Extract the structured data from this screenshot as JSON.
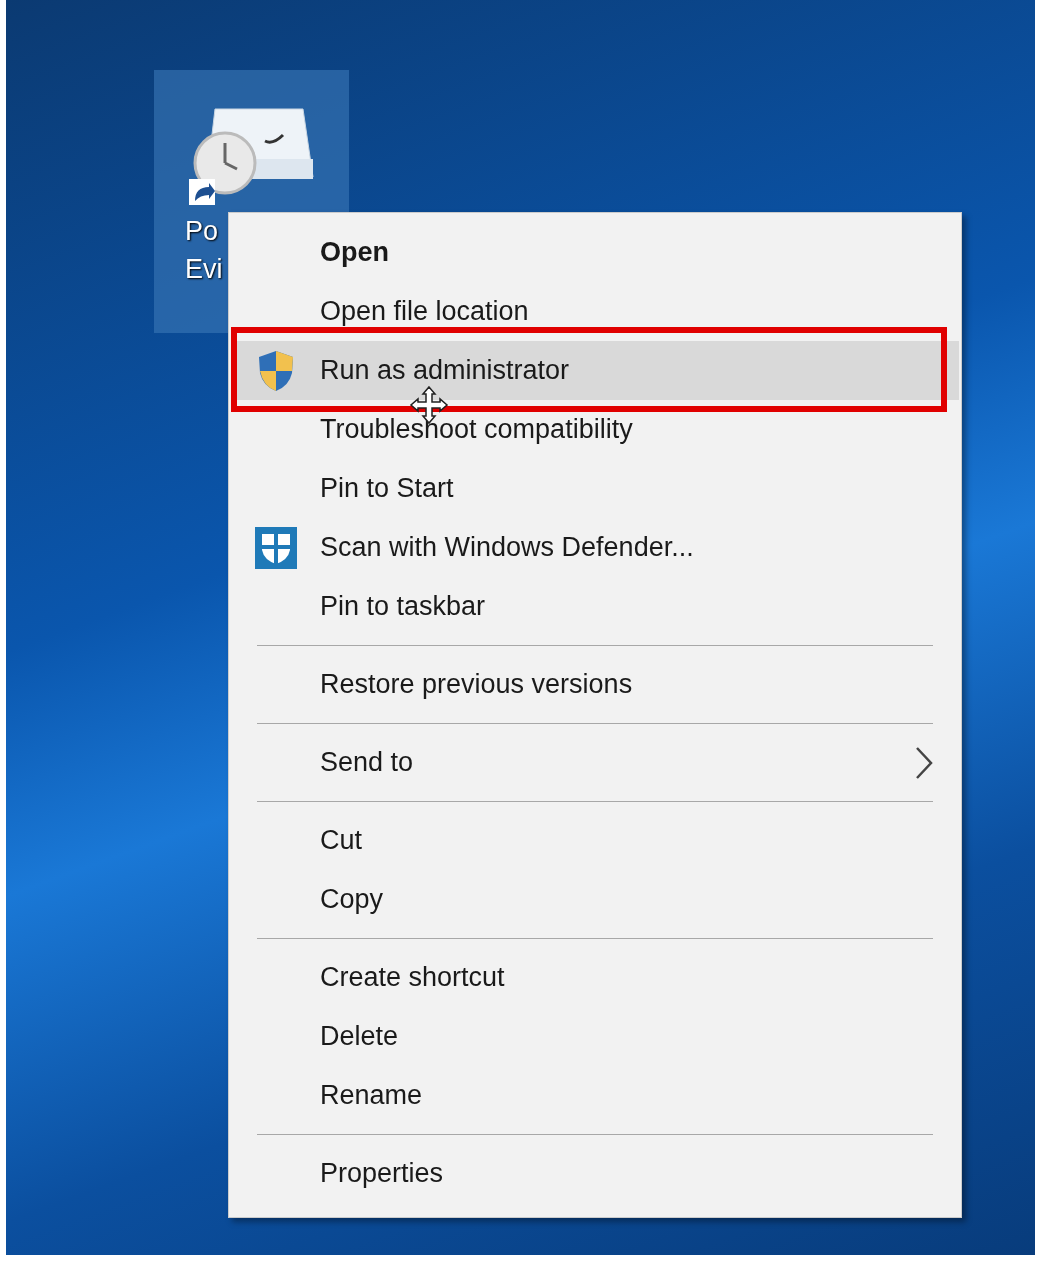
{
  "desktop_icon": {
    "label_lines": [
      "Po",
      "Evi"
    ],
    "selected": true
  },
  "context_menu": {
    "groups": [
      {
        "items": [
          {
            "label": "Open",
            "kind": "default",
            "selected": false
          },
          {
            "label": "Open file location",
            "kind": "normal",
            "selected": false
          },
          {
            "label": "Run as administrator",
            "kind": "shield",
            "selected": true
          },
          {
            "label": "Troubleshoot compatibility",
            "kind": "normal",
            "selected": false
          },
          {
            "label": "Pin to Start",
            "kind": "normal",
            "selected": false
          },
          {
            "label": "Scan with Windows Defender...",
            "kind": "defender",
            "selected": false
          },
          {
            "label": "Pin to taskbar",
            "kind": "normal",
            "selected": false
          }
        ]
      },
      {
        "items": [
          {
            "label": "Restore previous versions",
            "kind": "normal",
            "selected": false
          }
        ]
      },
      {
        "items": [
          {
            "label": "Send to",
            "kind": "submenu",
            "selected": false
          }
        ]
      },
      {
        "items": [
          {
            "label": "Cut",
            "kind": "normal",
            "selected": false
          },
          {
            "label": "Copy",
            "kind": "normal",
            "selected": false
          }
        ]
      },
      {
        "items": [
          {
            "label": "Create shortcut",
            "kind": "normal",
            "selected": false
          },
          {
            "label": "Delete",
            "kind": "normal",
            "selected": false
          },
          {
            "label": "Rename",
            "kind": "normal",
            "selected": false
          }
        ]
      },
      {
        "items": [
          {
            "label": "Properties",
            "kind": "normal",
            "selected": false
          }
        ]
      }
    ]
  }
}
